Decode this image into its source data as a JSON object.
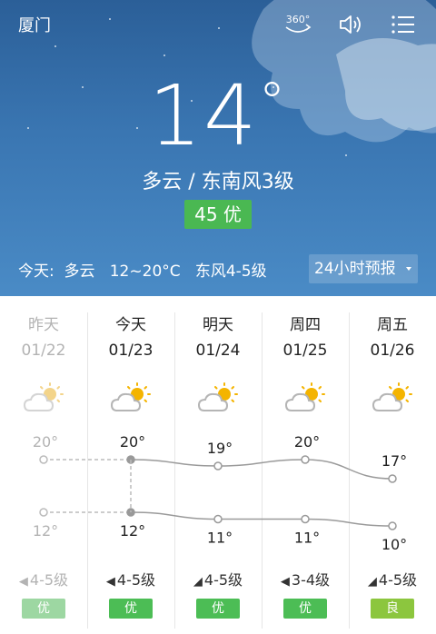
{
  "header": {
    "city": "厦门",
    "icons": [
      "360-view-icon",
      "speaker-icon",
      "menu-icon"
    ],
    "icon_360_label": "360°"
  },
  "current": {
    "temperature": "14",
    "degree_symbol": "°",
    "condition": "多云  /  东南风3级",
    "aqi": "45 优",
    "today_summary": "今天:  多云   12~20°C   东风4-5级",
    "forecast_button": "24小时预报"
  },
  "forecast": {
    "days": [
      {
        "name": "昨天",
        "date": "01/22",
        "high": "20°",
        "low": "12°",
        "wind": "4-5级",
        "quality": "优",
        "muted": true
      },
      {
        "name": "今天",
        "date": "01/23",
        "high": "20°",
        "low": "12°",
        "wind": "4-5级",
        "quality": "优",
        "muted": false
      },
      {
        "name": "明天",
        "date": "01/24",
        "high": "19°",
        "low": "11°",
        "wind": "4-5级",
        "quality": "优",
        "muted": false
      },
      {
        "name": "周四",
        "date": "01/25",
        "high": "20°",
        "low": "11°",
        "wind": "3-4级",
        "quality": "优",
        "muted": false
      },
      {
        "name": "周五",
        "date": "01/26",
        "high": "17°",
        "low": "10°",
        "wind": "4-5级",
        "quality": "良",
        "muted": false
      }
    ],
    "high_values": [
      20,
      20,
      19,
      20,
      17
    ],
    "low_values": [
      12,
      12,
      11,
      11,
      10
    ],
    "weather_icon": "partly-cloudy-icon",
    "colors": {
      "good": "#4cbd55",
      "moderate": "#8cc63e",
      "muted_good": "#9dd7a2",
      "line": "#9a9a9a"
    }
  }
}
